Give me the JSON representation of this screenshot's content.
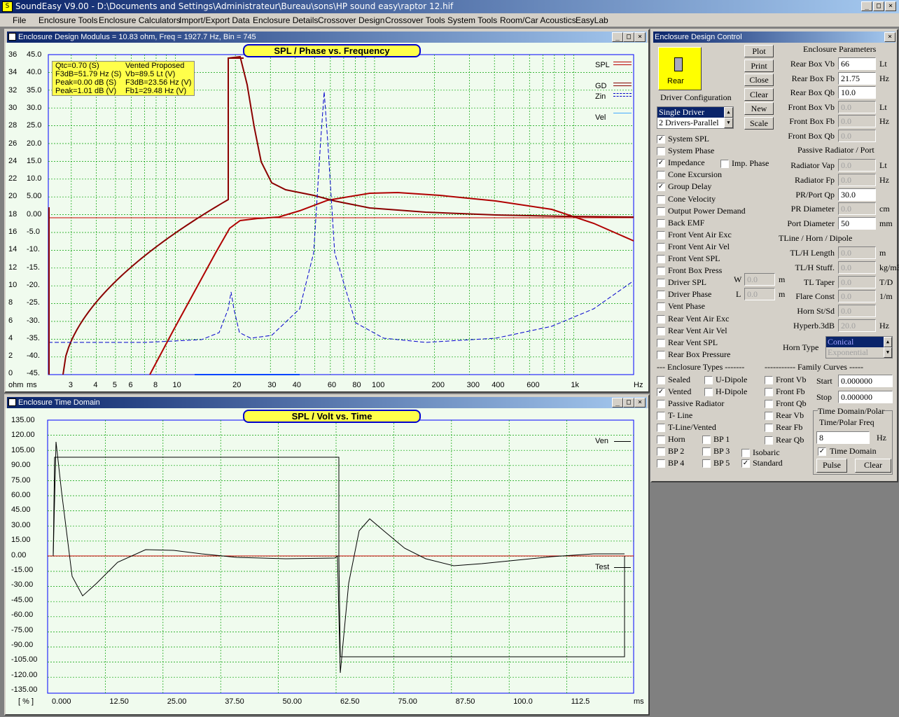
{
  "app": {
    "title": "SoundEasy V9.00 - D:\\Documents and Settings\\Administrateur\\Bureau\\sons\\HP sound easy\\raptor 12.hif"
  },
  "menu": [
    "File",
    "Enclosure Tools",
    "Enclosure Calculators",
    "Import/Export Data",
    "Enclosure Details",
    "Crossover Design",
    "Crossover Tools",
    "System Tools",
    "Room/Car Acoustics",
    "EasyLab"
  ],
  "win_design": {
    "title": "Enclosure Design  Modulus = 10.83 ohm, Freq = 1927.7 Hz, Bin = 745",
    "plot_title": "SPL / Phase vs. Frequency",
    "info": [
      [
        "Qtc=0.70 (S)",
        "Vented Proposed"
      ],
      [
        "F3dB=51.79 Hz (S)",
        "Vb=89.5 Lt (V)"
      ],
      [
        "Peak=0.00 dB (S)",
        "F3dB=23.56 Hz (V)"
      ],
      [
        "Peak=1.01 dB (V)",
        "Fb1=29.48 Hz (V)"
      ]
    ],
    "legend": [
      "SPL",
      "GD",
      "Zin",
      "Vel"
    ],
    "ohm_ticks": [
      "36",
      "34",
      "32",
      "30",
      "28",
      "26",
      "24",
      "22",
      "20",
      "18",
      "16",
      "14",
      "12",
      "10",
      "8",
      "6",
      "4",
      "2",
      "0"
    ],
    "ms_ticks": [
      "45.0",
      "40.0",
      "35.0",
      "30.0",
      "25.0",
      "20.0",
      "15.0",
      "10.0",
      "5.00",
      "0.00",
      "-5.0",
      "-10.",
      "-15.",
      "-20.",
      "-25.",
      "-30.",
      "-35.",
      "-40.",
      "-45."
    ],
    "x_ticks": [
      "3",
      "4",
      "5",
      "6",
      "8",
      "10",
      "20",
      "30",
      "40",
      "60",
      "80",
      "100",
      "200",
      "300",
      "400",
      "600",
      "1k"
    ],
    "unit_ohm": "ohm",
    "unit_ms": "ms",
    "unit_hz": "Hz"
  },
  "win_time": {
    "title": "Enclosure Time Domain",
    "plot_title": "SPL / Volt vs. Time",
    "y_ticks": [
      "135.00",
      "120.00",
      "105.00",
      "90.00",
      "75.00",
      "60.00",
      "45.00",
      "30.00",
      "15.00",
      "0.00",
      "-15.00",
      "-30.00",
      "-45.00",
      "-60.00",
      "-75.00",
      "-90.00",
      "-105.00",
      "-120.00",
      "-135.00"
    ],
    "x_ticks": [
      "0.000",
      "12.50",
      "25.00",
      "37.50",
      "50.00",
      "62.50",
      "75.00",
      "87.50",
      "100.0",
      "112.5"
    ],
    "unit_pct": "[ % ]",
    "unit_ms": "ms",
    "legend": [
      "Ven",
      "Test"
    ]
  },
  "control": {
    "title": "Enclosure Design Control",
    "rear_label": "Rear",
    "driver_config": "Driver Configuration",
    "buttons": [
      "Plot",
      "Print",
      "Close",
      "Clear",
      "New",
      "Scale"
    ],
    "driver_list": [
      "Single Driver",
      "2 Drivers-Parallel"
    ],
    "checks": [
      [
        "System SPL",
        true
      ],
      [
        "System Phase",
        false
      ],
      [
        "Impedance",
        true
      ],
      [
        "Cone Excursion",
        false
      ],
      [
        "Group Delay",
        true
      ],
      [
        "Cone Velocity",
        false
      ],
      [
        "Output Power Demand",
        false
      ],
      [
        "Back EMF",
        false
      ],
      [
        "Front Vent Air Exc",
        false
      ],
      [
        "Front Vent Air Vel",
        false
      ],
      [
        "Front Vent SPL",
        false
      ],
      [
        "Front Box Press",
        false
      ],
      [
        "Driver SPL",
        false
      ],
      [
        "Driver Phase",
        false
      ],
      [
        "Vent Phase",
        false
      ],
      [
        "Rear Vent Air Exc",
        false
      ],
      [
        "Rear Vent Air Vel",
        false
      ],
      [
        "Rear Vent SPL",
        false
      ],
      [
        "Rear Box Pressure",
        false
      ]
    ],
    "imp_phase": "Imp. Phase",
    "wl": [
      [
        "W",
        "0.0",
        "m"
      ],
      [
        "L",
        "0.0",
        "m"
      ]
    ],
    "enc_params_title": "Enclosure Parameters",
    "params": [
      [
        "Rear Box Vb",
        "66",
        "Lt",
        false
      ],
      [
        "Rear Box Fb",
        "21.75",
        "Hz",
        false
      ],
      [
        "Rear Box Qb",
        "10.0",
        "",
        false
      ],
      [
        "Front Box Vb",
        "0.0",
        "Lt",
        true
      ],
      [
        "Front Box Fb",
        "0.0",
        "Hz",
        true
      ],
      [
        "Front Box Qb",
        "0.0",
        "",
        true
      ]
    ],
    "pr_title": "Passive Radiator / Port",
    "pr_params": [
      [
        "Radiator Vap",
        "0.0",
        "Lt",
        true
      ],
      [
        "Radiator Fp",
        "0.0",
        "Hz",
        true
      ],
      [
        "PR/Port Qp",
        "30.0",
        "",
        false
      ],
      [
        "PR Diameter",
        "0.0",
        "cm",
        true
      ],
      [
        "Port Diameter",
        "50",
        "mm",
        false
      ]
    ],
    "tl_title": "TLine / Horn / Dipole",
    "tl_params": [
      [
        "TL/H Length",
        "0.0",
        "m",
        true
      ],
      [
        "TL/H Stuff.",
        "0.0",
        "kg/m3",
        true
      ],
      [
        "TL Taper",
        "0.0",
        "T/D",
        true
      ],
      [
        "Flare Const",
        "0.0",
        "1/m",
        true
      ],
      [
        "Horn St/Sd",
        "0.0",
        "",
        true
      ],
      [
        "Hyperb.3dB",
        "20.0",
        "Hz",
        true
      ]
    ],
    "horn_type": "Horn Type",
    "horn_options": [
      "Conical",
      "Exponential"
    ],
    "enc_types_title": "--- Enclosure Types -------",
    "enc_types": [
      [
        "Sealed",
        false
      ],
      [
        "U-Dipole",
        false
      ],
      [
        "Vented",
        true
      ],
      [
        "H-Dipole",
        false
      ],
      [
        "Passive Radiator",
        false
      ],
      [
        "T- Line",
        false
      ],
      [
        "T-Line/Vented",
        false
      ],
      [
        "Horn",
        false
      ],
      [
        "BP 1",
        false
      ],
      [
        "BP 2",
        false
      ],
      [
        "BP 3",
        false
      ],
      [
        "BP 4",
        false
      ],
      [
        "BP 5",
        false
      ]
    ],
    "iso": [
      [
        "Isobaric",
        false
      ],
      [
        "Standard",
        true
      ]
    ],
    "family_title": "----------- Family Curves -----",
    "family": [
      [
        "Front Vb",
        false
      ],
      [
        "Front Fb",
        false
      ],
      [
        "Front Qb",
        false
      ],
      [
        "Rear Vb",
        false
      ],
      [
        "Rear Fb",
        false
      ],
      [
        "Rear Qb",
        false
      ]
    ],
    "start_label": "Start",
    "start_val": "0.000000",
    "stop_label": "Stop",
    "stop_val": "0.000000",
    "td_title1": "Time Domain/Polar",
    "td_title2": "Time/Polar Freq",
    "td_freq": "8",
    "td_unit": "Hz",
    "td_check": "Time Domain",
    "pulse": "Pulse",
    "clear": "Clear"
  },
  "colors": {
    "spl": "#8b0000",
    "zin": "#0000cc",
    "grid": "#00aa00",
    "plotbg": "#f0fbee"
  }
}
